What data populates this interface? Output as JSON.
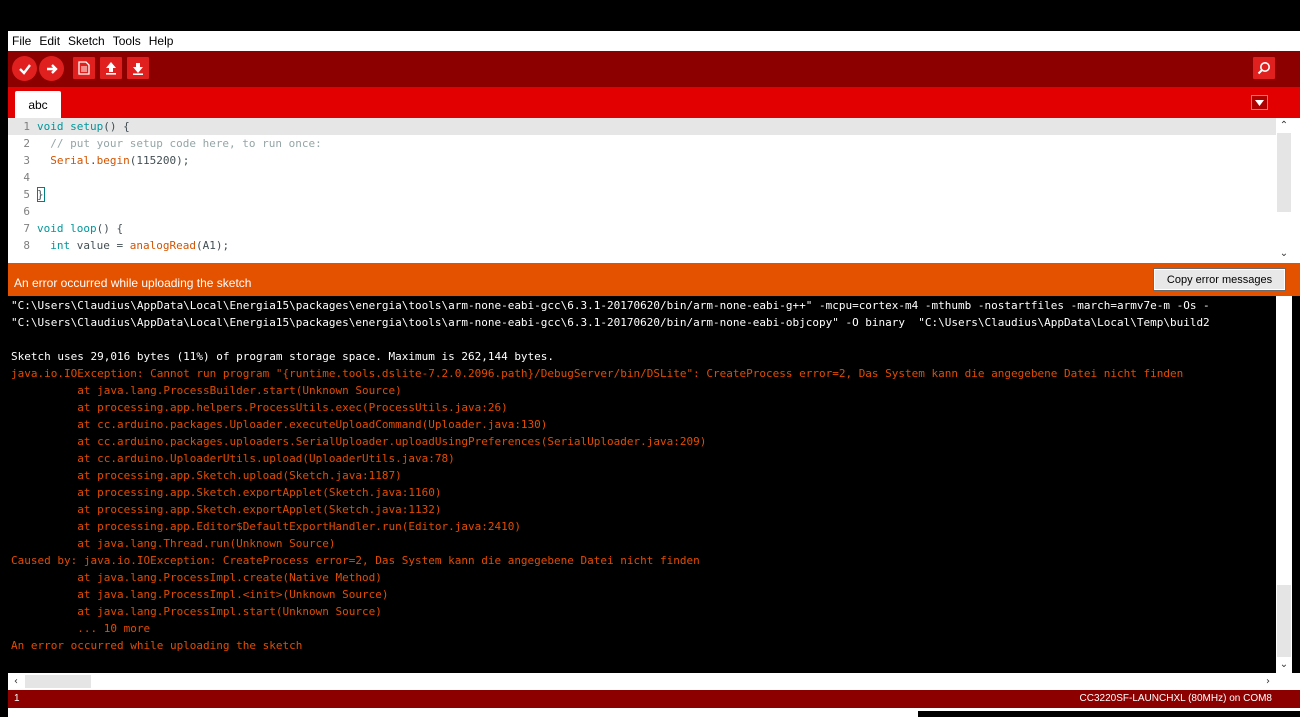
{
  "menu": [
    "File",
    "Edit",
    "Sketch",
    "Tools",
    "Help"
  ],
  "toolbar": {
    "buttons": [
      "verify",
      "upload",
      "new",
      "open",
      "save"
    ],
    "serial_monitor": "serial-monitor"
  },
  "colors": {
    "toolbar": "#8c0000",
    "tabbar": "#e30000",
    "status_error": "#e45200",
    "console_error_text": "#e34c00"
  },
  "tab": {
    "label": "abc"
  },
  "editor": {
    "lines": [
      {
        "n": "1",
        "parts": [
          {
            "t": "void",
            "c": "kw"
          },
          {
            "t": " "
          },
          {
            "t": "setup",
            "c": "kw"
          },
          {
            "t": "() {"
          }
        ]
      },
      {
        "n": "2",
        "parts": [
          {
            "t": "  "
          },
          {
            "t": "// put your setup code here, to run once:",
            "c": "cm"
          }
        ]
      },
      {
        "n": "3",
        "parts": [
          {
            "t": "  "
          },
          {
            "t": "Serial",
            "c": "fn"
          },
          {
            "t": "."
          },
          {
            "t": "begin",
            "c": "fn"
          },
          {
            "t": "(115200);"
          }
        ]
      },
      {
        "n": "4",
        "parts": []
      },
      {
        "n": "5",
        "parts": [
          {
            "t": "}"
          }
        ]
      },
      {
        "n": "6",
        "parts": []
      },
      {
        "n": "7",
        "parts": [
          {
            "t": "void",
            "c": "kw"
          },
          {
            "t": " "
          },
          {
            "t": "loop",
            "c": "kw"
          },
          {
            "t": "() {"
          }
        ]
      },
      {
        "n": "8",
        "parts": [
          {
            "t": "  "
          },
          {
            "t": "int",
            "c": "kw"
          },
          {
            "t": " value = "
          },
          {
            "t": "analogRead",
            "c": "fn"
          },
          {
            "t": "(A1);"
          }
        ]
      }
    ]
  },
  "status": {
    "message": "An error occurred while uploading the sketch",
    "copy_button": "Copy error messages"
  },
  "console": {
    "lines": [
      {
        "t": "\"C:\\Users\\Claudius\\AppData\\Local\\Energia15\\packages\\energia\\tools\\arm-none-eabi-gcc\\6.3.1-20170620/bin/arm-none-eabi-g++\" -mcpu=cortex-m4 -mthumb -nostartfiles -march=armv7e-m -Os -",
        "c": "out"
      },
      {
        "t": "\"C:\\Users\\Claudius\\AppData\\Local\\Energia15\\packages\\energia\\tools\\arm-none-eabi-gcc\\6.3.1-20170620/bin/arm-none-eabi-objcopy\" -O binary  \"C:\\Users\\Claudius\\AppData\\Local\\Temp\\build2",
        "c": "out"
      },
      {
        "t": "",
        "c": "out"
      },
      {
        "t": "Sketch uses 29,016 bytes (11%) of program storage space. Maximum is 262,144 bytes.",
        "c": "out"
      },
      {
        "t": "java.io.IOException: Cannot run program \"{runtime.tools.dslite-7.2.0.2096.path}/DebugServer/bin/DSLite\": CreateProcess error=2, Das System kann die angegebene Datei nicht finden",
        "c": "err"
      },
      {
        "t": "          at java.lang.ProcessBuilder.start(Unknown Source)",
        "c": "err"
      },
      {
        "t": "          at processing.app.helpers.ProcessUtils.exec(ProcessUtils.java:26)",
        "c": "err"
      },
      {
        "t": "          at cc.arduino.packages.Uploader.executeUploadCommand(Uploader.java:130)",
        "c": "err"
      },
      {
        "t": "          at cc.arduino.packages.uploaders.SerialUploader.uploadUsingPreferences(SerialUploader.java:209)",
        "c": "err"
      },
      {
        "t": "          at cc.arduino.UploaderUtils.upload(UploaderUtils.java:78)",
        "c": "err"
      },
      {
        "t": "          at processing.app.Sketch.upload(Sketch.java:1187)",
        "c": "err"
      },
      {
        "t": "          at processing.app.Sketch.exportApplet(Sketch.java:1160)",
        "c": "err"
      },
      {
        "t": "          at processing.app.Sketch.exportApplet(Sketch.java:1132)",
        "c": "err"
      },
      {
        "t": "          at processing.app.Editor$DefaultExportHandler.run(Editor.java:2410)",
        "c": "err"
      },
      {
        "t": "          at java.lang.Thread.run(Unknown Source)",
        "c": "err"
      },
      {
        "t": "Caused by: java.io.IOException: CreateProcess error=2, Das System kann die angegebene Datei nicht finden",
        "c": "err"
      },
      {
        "t": "          at java.lang.ProcessImpl.create(Native Method)",
        "c": "err"
      },
      {
        "t": "          at java.lang.ProcessImpl.<init>(Unknown Source)",
        "c": "err"
      },
      {
        "t": "          at java.lang.ProcessImpl.start(Unknown Source)",
        "c": "err"
      },
      {
        "t": "          ... 10 more",
        "c": "err"
      },
      {
        "t": "An error occurred while uploading the sketch",
        "c": "err"
      }
    ]
  },
  "footer": {
    "line": "1",
    "board": "CC3220SF-LAUNCHXL (80MHz) on COM8"
  }
}
